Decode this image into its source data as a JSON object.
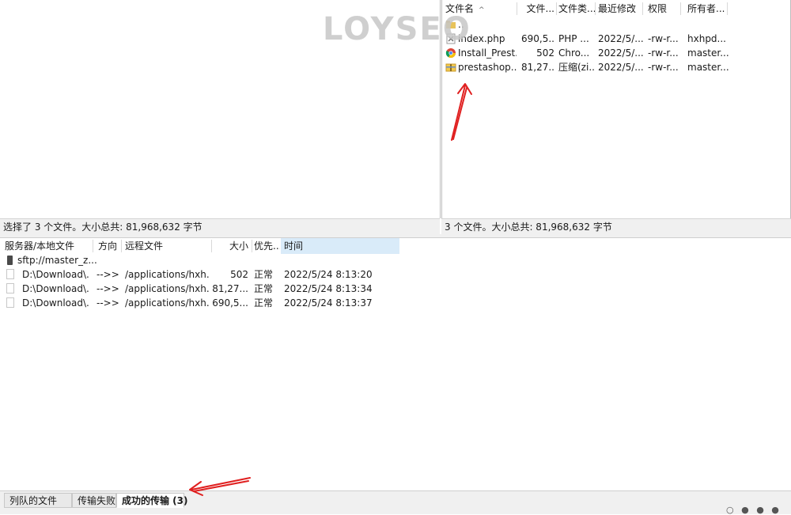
{
  "watermark": {
    "text": "LOYSEO"
  },
  "local": {
    "status": "选择了 3 个文件。大小总共: 81,968,632 字节"
  },
  "remote": {
    "headers": {
      "name": "文件名",
      "size": "文件...",
      "type": "文件类...",
      "modified": "最近修改",
      "perm": "权限",
      "owner": "所有者..."
    },
    "files": [
      {
        "name": "..",
        "size": "",
        "type": "",
        "modified": "",
        "perm": "",
        "owner": "",
        "icon": "parent-folder-icon"
      },
      {
        "name": "index.php",
        "size": "690,5...",
        "type": "PHP ...",
        "modified": "2022/5/...",
        "perm": "-rw-r...",
        "owner": "hxhpd...",
        "icon": "php-file-icon"
      },
      {
        "name": "Install_Prest...",
        "size": "502",
        "type": "Chro...",
        "modified": "2022/5/...",
        "perm": "-rw-r...",
        "owner": "master...",
        "icon": "chrome-icon"
      },
      {
        "name": "prestashop....",
        "size": "81,27...",
        "type": "压缩(zi...",
        "modified": "2022/5/...",
        "perm": "-rw-r...",
        "owner": "master...",
        "icon": "zip-archive-icon"
      }
    ],
    "status": "3 个文件。大小总共: 81,968,632 字节"
  },
  "queue": {
    "headers": {
      "local": "服务器/本地文件",
      "direction": "方向",
      "remote": "远程文件",
      "size": "大小",
      "priority": "优先...",
      "time": "时间"
    },
    "server": "sftp://master_z...",
    "rows": [
      {
        "local": "D:\\Download\\...",
        "direction": "-->>",
        "remote": "/applications/hxh...",
        "size": "502",
        "priority": "正常",
        "time": "2022/5/24 8:13:20"
      },
      {
        "local": "D:\\Download\\...",
        "direction": "-->>",
        "remote": "/applications/hxh...",
        "size": "81,27...",
        "priority": "正常",
        "time": "2022/5/24 8:13:34"
      },
      {
        "local": "D:\\Download\\...",
        "direction": "-->>",
        "remote": "/applications/hxh...",
        "size": "690,5...",
        "priority": "正常",
        "time": "2022/5/24 8:13:37"
      }
    ]
  },
  "tabs": [
    {
      "label": "列队的文件"
    },
    {
      "label": "传输失败"
    },
    {
      "label": "成功的传输 (3)"
    }
  ],
  "colors": {
    "annotation_red": "#e02020",
    "active_header": "#d9ebf9"
  }
}
